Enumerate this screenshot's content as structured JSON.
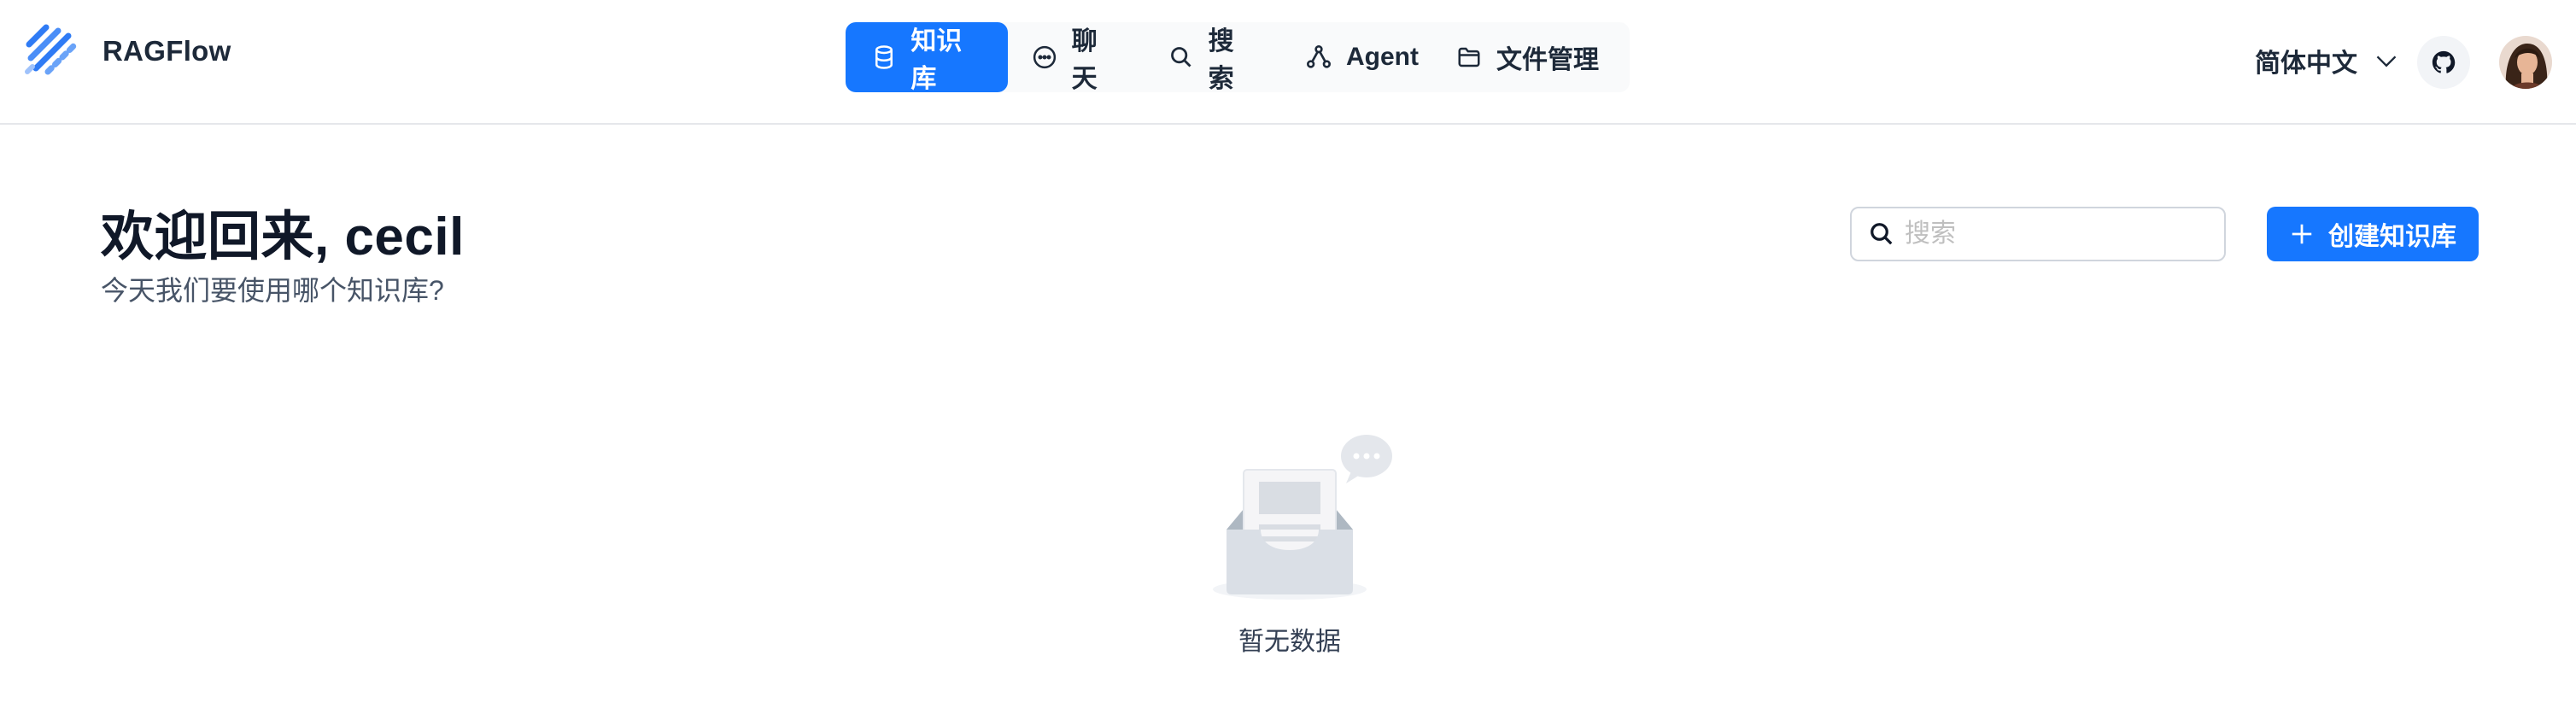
{
  "app": {
    "name": "RAGFlow"
  },
  "nav": {
    "items": [
      {
        "label": "知识库",
        "icon": "database-icon",
        "active": true
      },
      {
        "label": "聊天",
        "icon": "chat-bubble-icon"
      },
      {
        "label": "搜索",
        "icon": "search-icon"
      },
      {
        "label": "Agent",
        "icon": "agent-graph-icon"
      },
      {
        "label": "文件管理",
        "icon": "folder-icon"
      }
    ]
  },
  "header": {
    "language": "简体中文"
  },
  "main": {
    "welcome": "欢迎回来, cecil",
    "subtitle": "今天我们要使用哪个知识库?",
    "search_placeholder": "搜索",
    "create_label": "创建知识库",
    "empty_text": "暂无数据"
  },
  "colors": {
    "accent": "#1677ff",
    "nav_bg": "#f9fafb"
  }
}
